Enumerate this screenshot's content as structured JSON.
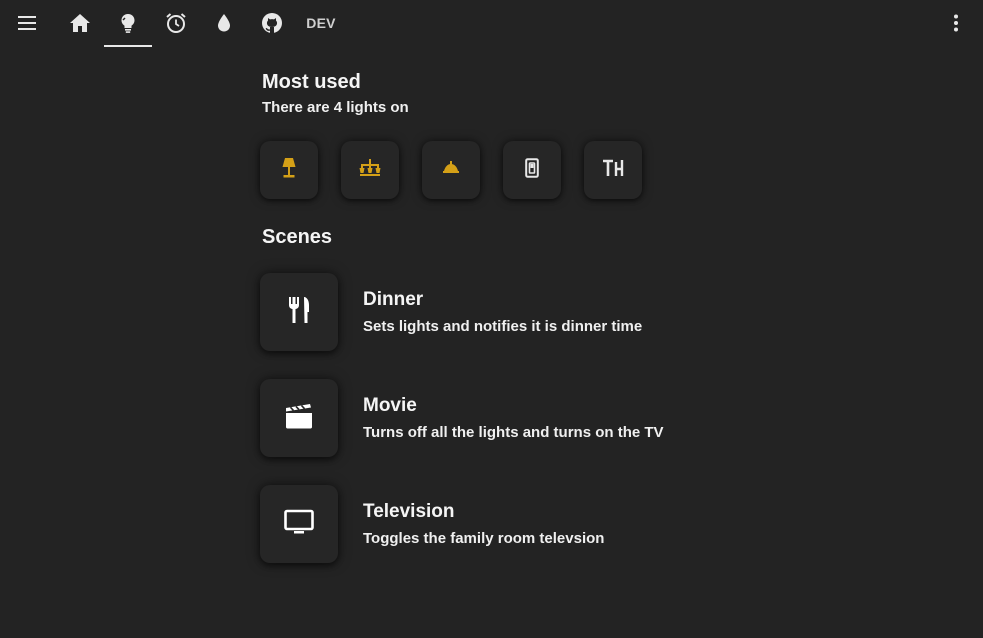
{
  "toolbar": {
    "tabs": [
      {
        "icon": "menu-icon"
      },
      {
        "icon": "home-icon"
      },
      {
        "icon": "lightbulb-icon",
        "active": true
      },
      {
        "icon": "alarm-clock-icon"
      },
      {
        "icon": "water-drop-icon"
      },
      {
        "icon": "github-icon"
      }
    ],
    "dev_label": "DEV",
    "overflow_icon": "more-vert-icon"
  },
  "most_used": {
    "title": "Most used",
    "subtitle": "There are 4 lights on",
    "lights": [
      {
        "icon": "floor-lamp-icon",
        "on": true
      },
      {
        "icon": "chandelier-icon",
        "on": true
      },
      {
        "icon": "ceiling-light-icon",
        "on": true
      },
      {
        "icon": "light-switch-icon",
        "on": false
      },
      {
        "icon": "text-format-icon",
        "on": false
      }
    ]
  },
  "scenes": {
    "title": "Scenes",
    "items": [
      {
        "name": "Dinner",
        "description": "Sets lights and notifies it is dinner time",
        "icon": "silverware-icon"
      },
      {
        "name": "Movie",
        "description": "Turns off all the lights and turns on the TV",
        "icon": "clapperboard-icon"
      },
      {
        "name": "Television",
        "description": "Toggles the family room televsion",
        "icon": "television-icon"
      }
    ]
  },
  "colors": {
    "background": "#232323",
    "light_on": "#d4a017",
    "icon_default": "#e8e8e8",
    "text": "#f2f2f2"
  }
}
